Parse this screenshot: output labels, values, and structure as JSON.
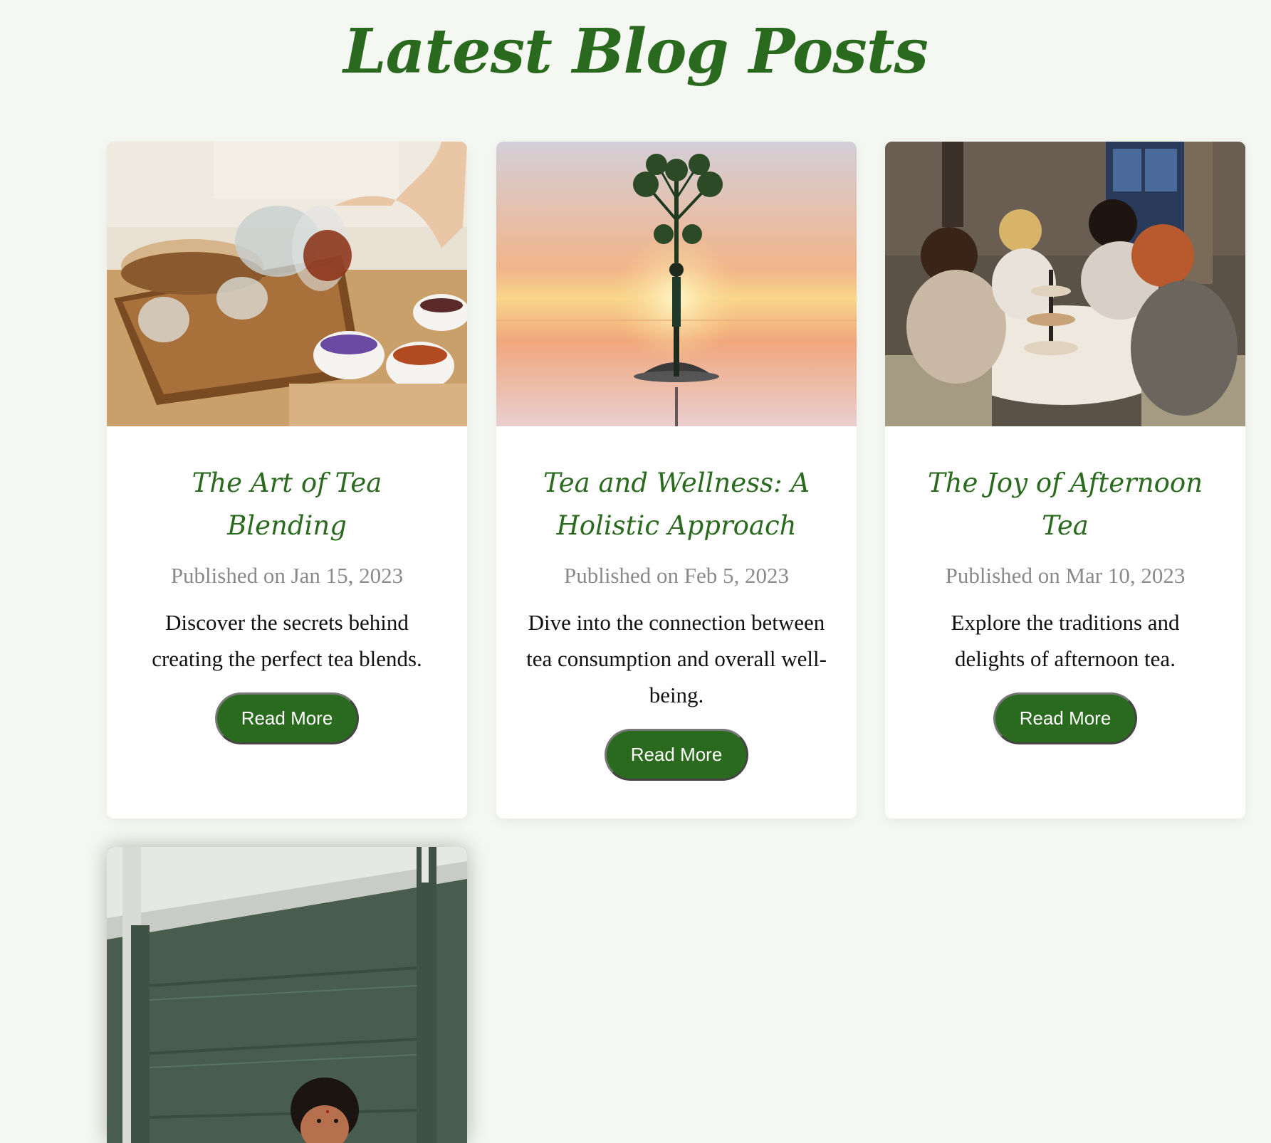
{
  "page": {
    "title": "Latest Blog Posts"
  },
  "posts": [
    {
      "title": "The Art of Tea Blending",
      "date": "Published on Jan 15, 2023",
      "excerpt": "Discover the secrets behind creating the perfect tea blends.",
      "button": "Read More",
      "image_alt": "Hands arranging tea ingredients beside a glass teapot"
    },
    {
      "title": "Tea and Wellness: A Holistic Approach",
      "date": "Published on Feb 5, 2023",
      "excerpt": "Dive into the connection between tea consumption and overall well-being.",
      "button": "Read More",
      "image_alt": "Silhouette in a yoga tree pose against a sunset over water"
    },
    {
      "title": "The Joy of Afternoon Tea",
      "date": "Published on Mar 10, 2023",
      "excerpt": "Explore the traditions and delights of afternoon tea.",
      "button": "Read More",
      "image_alt": "Friends sharing afternoon tea around a table"
    },
    {
      "image_alt": "Woman in front of a green paneled wall"
    }
  ],
  "colors": {
    "background": "#f5f8f2",
    "accent_green": "#2a6a1e",
    "date_gray": "#8a8a8a"
  }
}
